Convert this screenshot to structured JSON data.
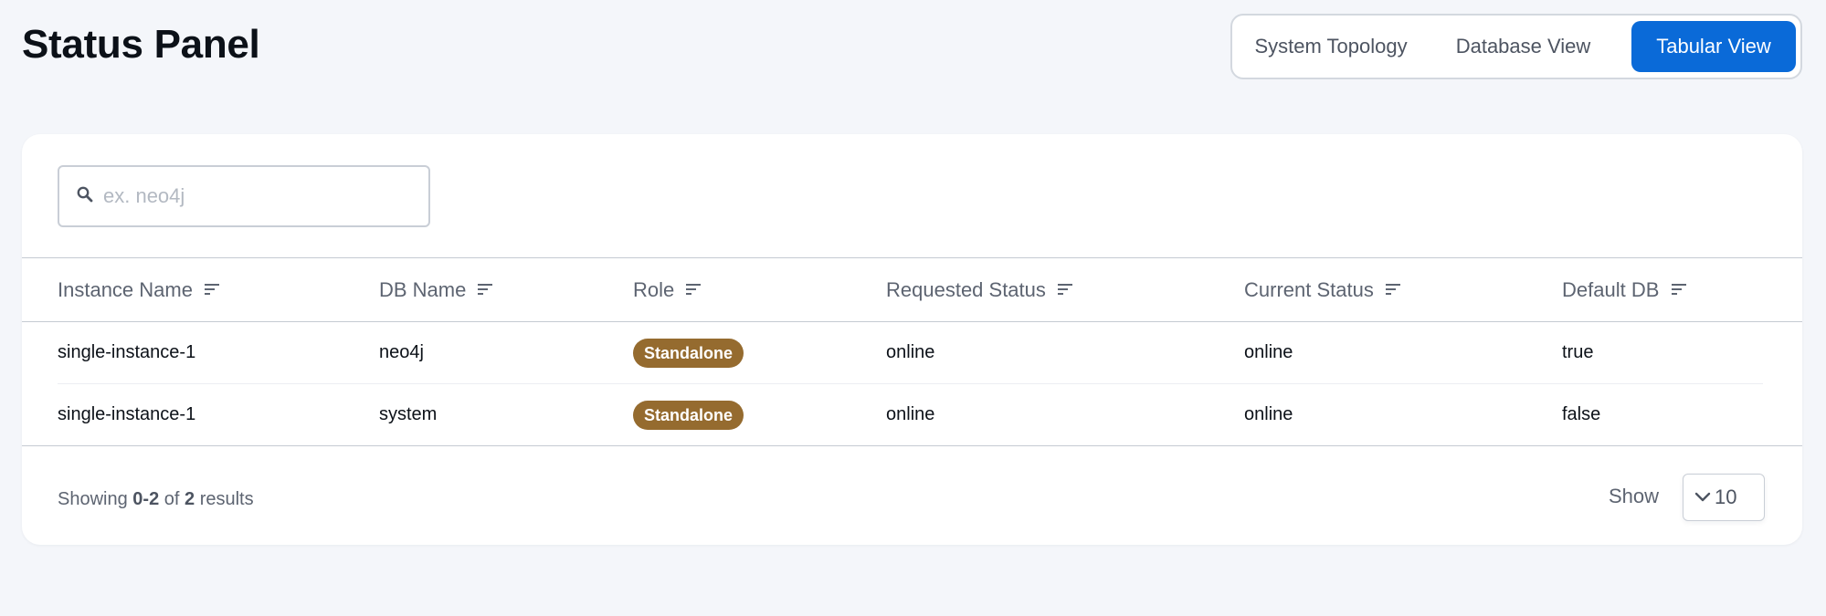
{
  "page": {
    "title": "Status Panel"
  },
  "view_switch": {
    "options": [
      "System Topology",
      "Database View",
      "Tabular View"
    ],
    "selected": "Tabular View"
  },
  "search": {
    "placeholder": "ex. neo4j",
    "value": ""
  },
  "table": {
    "columns": [
      "Instance Name",
      "DB Name",
      "Role",
      "Requested Status",
      "Current Status",
      "Default DB"
    ],
    "rows": [
      {
        "instance_name": "single-instance-1",
        "db_name": "neo4j",
        "role": "Standalone",
        "requested_status": "online",
        "current_status": "online",
        "default_db": "true"
      },
      {
        "instance_name": "single-instance-1",
        "db_name": "system",
        "role": "Standalone",
        "requested_status": "online",
        "current_status": "online",
        "default_db": "false"
      }
    ]
  },
  "footer": {
    "showing_prefix": "Showing",
    "range": "0-2",
    "of_text": "of",
    "total": "2",
    "results_text": "results",
    "show_label": "Show",
    "page_size": "10"
  },
  "colors": {
    "accent": "#0a6ad8",
    "badge": "#956b2f",
    "background": "#f4f6fa"
  },
  "icons": {
    "search": "search-icon",
    "sort": "sort-icon",
    "dropdown": "chevron-down-icon"
  }
}
